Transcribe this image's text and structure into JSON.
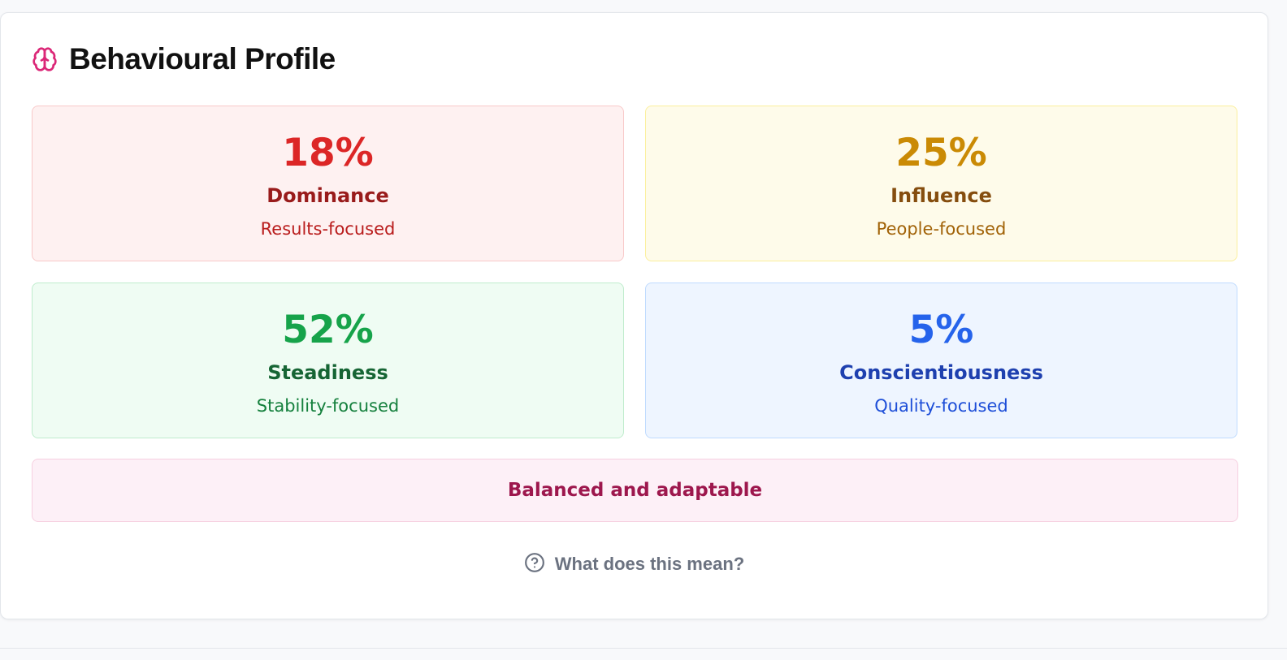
{
  "profile": {
    "title": "Behavioural Profile",
    "title_icon": "brain-icon",
    "accent_color": "#db2777",
    "traits": [
      {
        "percent": "18%",
        "name": "Dominance",
        "focus": "Results-focused",
        "colors": {
          "bg": "#fef1f1",
          "border": "#f8c9c9",
          "percent": "#dc2626",
          "name": "#991b1b",
          "focus": "#b91c1c"
        }
      },
      {
        "percent": "25%",
        "name": "Influence",
        "focus": "People-focused",
        "colors": {
          "bg": "#fefbea",
          "border": "#fbef9d",
          "percent": "#ca8a04",
          "name": "#854d0e",
          "focus": "#a16207"
        }
      },
      {
        "percent": "52%",
        "name": "Steadiness",
        "focus": "Stability-focused",
        "colors": {
          "bg": "#effcf3",
          "border": "#bfeccd",
          "percent": "#16a34a",
          "name": "#166534",
          "focus": "#15803d"
        }
      },
      {
        "percent": "5%",
        "name": "Conscientiousness",
        "focus": "Quality-focused",
        "colors": {
          "bg": "#eef5ff",
          "border": "#bfdbfe",
          "percent": "#2563eb",
          "name": "#1e40af",
          "focus": "#1d4ed8"
        }
      }
    ],
    "summary": "Balanced and adaptable",
    "help_label": "What does this mean?",
    "help_icon": "question-circle-icon"
  }
}
